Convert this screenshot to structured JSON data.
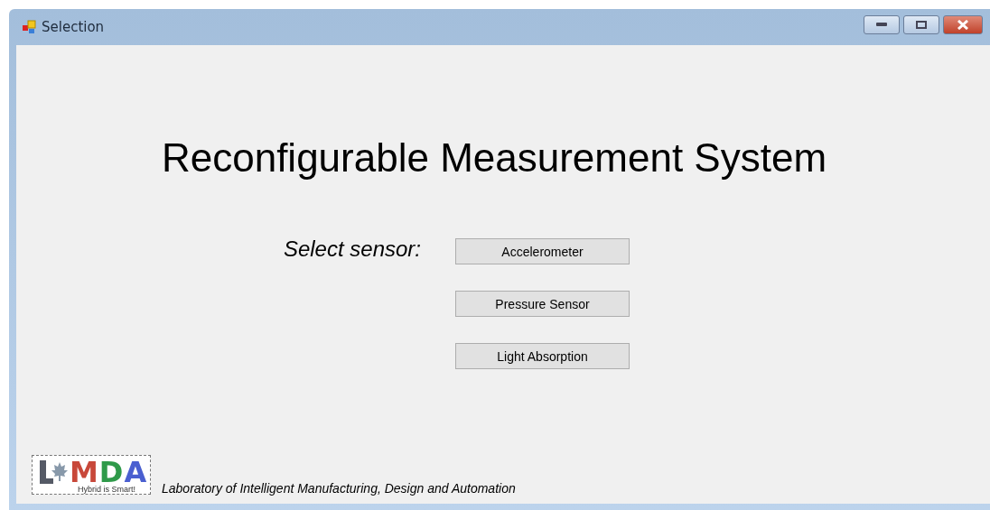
{
  "window": {
    "title": "Selection"
  },
  "heading": "Reconfigurable Measurement System",
  "prompt": "Select sensor:",
  "buttons": [
    "Accelerometer",
    "Pressure Sensor",
    "Light Absorption"
  ],
  "logo": {
    "letters": [
      {
        "char": "M",
        "color": "#c8483a"
      },
      {
        "char": "D",
        "color": "#2f9a4a"
      },
      {
        "char": "A",
        "color": "#4a5fd0"
      }
    ],
    "tagline": "Hybrid is Smart!"
  },
  "footer": "Laboratory of Intelligent Manufacturing, Design and Automation"
}
